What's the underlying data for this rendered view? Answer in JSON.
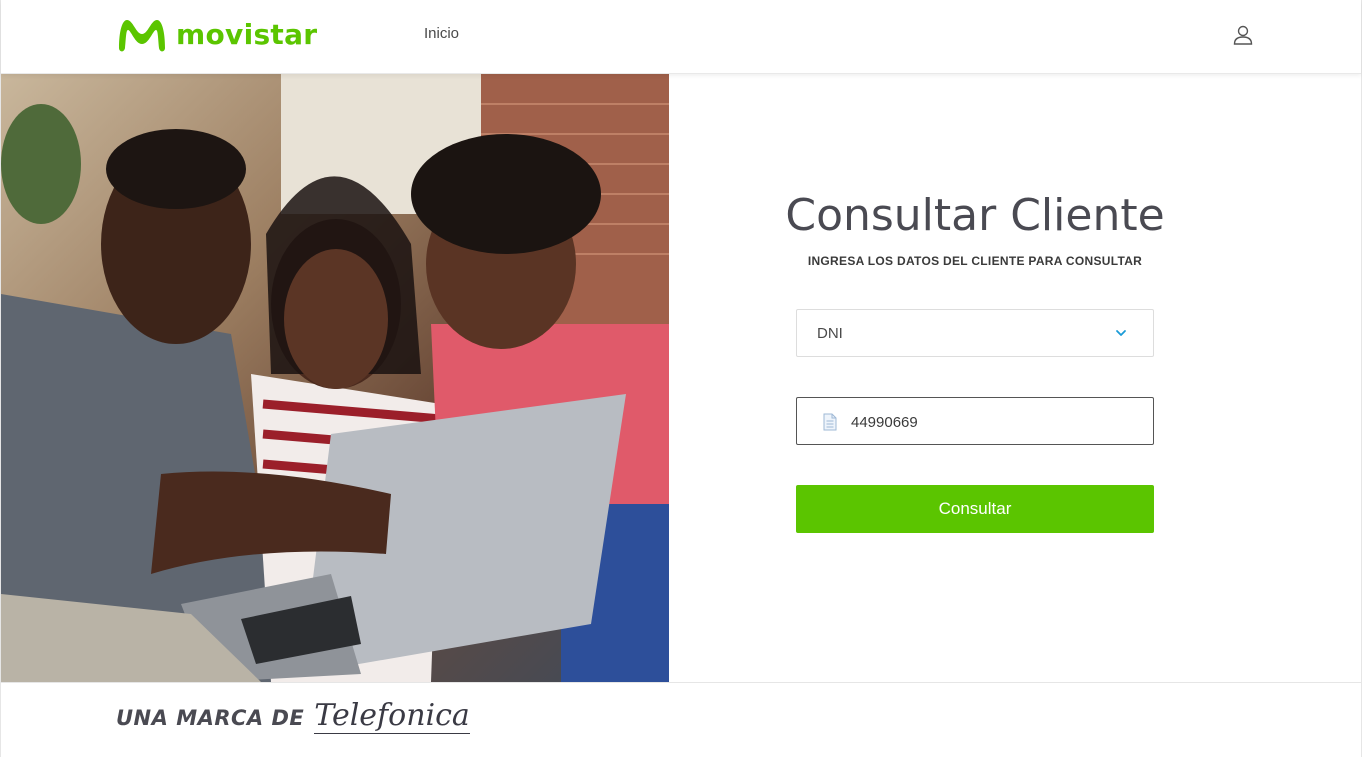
{
  "header": {
    "logo_text": "movistar",
    "nav_inicio": "Inicio",
    "brand_color": "#5bc500"
  },
  "hero": {
    "description_icon": "family-with-laptop-photo"
  },
  "form": {
    "title": "Consultar Cliente",
    "subtitle": "INGRESA LOS DATOS DEL CLIENTE PARA CONSULTAR",
    "document_type": {
      "selected": "DNI"
    },
    "document_number": {
      "value": "44990669"
    },
    "submit_label": "Consultar",
    "accent": "#5bc500"
  },
  "footer": {
    "brand_prefix": "UNA MARCA DE",
    "brand_name": "Telefonica"
  }
}
